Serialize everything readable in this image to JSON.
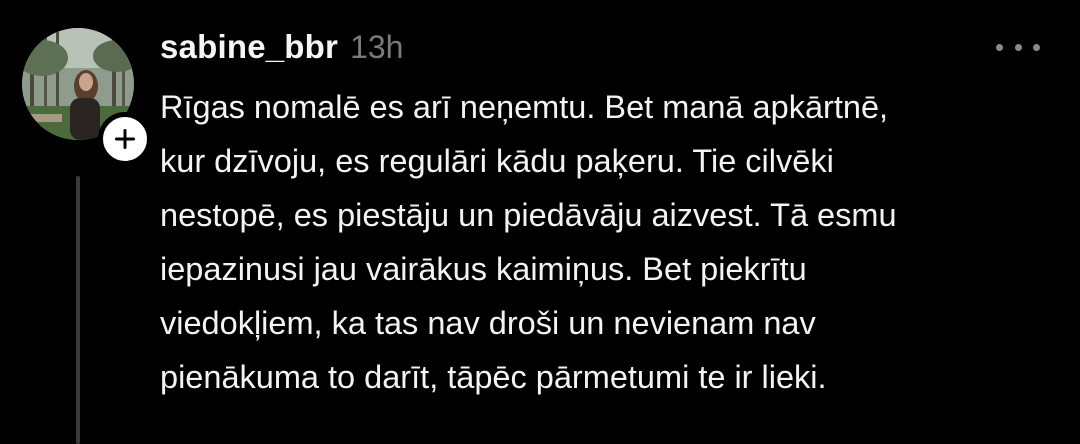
{
  "post": {
    "username": "sabine_bbr",
    "timestamp": "13h",
    "more_icon": "more-horizontal-icon",
    "follow_icon": "plus-icon",
    "body_lines": [
      "Rīgas nomalē es arī neņemtu. Bet manā apkārtnē,",
      "kur dzīvoju, es regulāri kādu paķeru. Tie cilvēki",
      "nestopē, es piestāju un piedāvāju aizvest. Tā esmu",
      "iepazinusi jau vairākus kaimiņus. Bet piekrītu",
      "viedokļiem, ka tas nav droši un nevienam nav",
      "pienākuma to darīt, tāpēc pārmetumi te ir lieki."
    ]
  },
  "colors": {
    "background": "#000000",
    "text_primary": "#f5f5f5",
    "text_secondary": "#7a7a7a",
    "thread_line": "#3a3a3a"
  }
}
